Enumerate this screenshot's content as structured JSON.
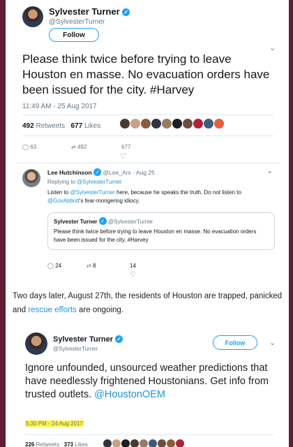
{
  "tweet1": {
    "name": "Sylvester Turner",
    "handle": "@SylvesterTurner",
    "follow_label": "Follow",
    "text": "Please think twice before trying to leave Houston en masse. No evacuation orders have been issued for the city. #Harvey",
    "time": "11:49 AM - 25 Aug 2017",
    "retweets_count": "492",
    "retweets_label": "Retweets",
    "likes_count": "677",
    "likes_label": "Likes",
    "reply_count": "63",
    "retweet_action_count": "492",
    "like_action_count": "677",
    "liker_colors": [
      "#4a3a30",
      "#c7a184",
      "#8a5c3b",
      "#2f3440",
      "#9b7a62",
      "#1e1e1e",
      "#6d4c3a",
      "#b22234",
      "#3d5a80",
      "#e0603a"
    ]
  },
  "reply": {
    "name": "Lee Hutchinson",
    "handle": "@Lee_Ars",
    "date": "· Aug 25",
    "replying_prefix": "Replying to",
    "replying_handle": "@SylvesterTurner",
    "body_1": "Listen to",
    "mention_1": "@SylvesterTurner",
    "body_2": "here, because he speaks the truth. Do not listen to",
    "mention_2": "@GovAbbott",
    "body_3": "'s fear-mongering idiocy.",
    "quote_name": "Sylvester Turner",
    "quote_handle": "@SylvesterTurner",
    "quote_text": "Please think twice before trying to leave Houston en masse. No evacuation orders have been issued for the city. #Harvey",
    "reply_count": "24",
    "retweet_count": "8",
    "like_count": "14"
  },
  "narration": {
    "part1": "Two days later, August 27th, the residents of Houston are trapped, panicked and ",
    "link": "rescue efforts",
    "part2": " are ongoing."
  },
  "tweet2": {
    "name": "Sylvester Turner",
    "handle": "@SylvesterTurner",
    "follow_label": "Follow",
    "text": "Ignore unfounded, unsourced weather predictions that have needlessly frightened Houstonians. Get info from trusted outlets.",
    "mention": "@HoustonOEM",
    "time": "5:30 PM - 24 Aug 2017",
    "retweets_count": "226",
    "retweets_label": "Retweets",
    "likes_count": "373",
    "likes_label": "Likes",
    "liker_colors": [
      "#2f3440",
      "#c7a184",
      "#1e1e1e",
      "#4a3a30",
      "#9b7a62",
      "#3d5a80",
      "#6d4c3a",
      "#8a5c3b",
      "#b22234"
    ]
  },
  "colors": {
    "frame": "#5e1f35",
    "link_blue": "#1b95e0",
    "verified_blue": "#1da1f2",
    "highlight": "#fff33a"
  },
  "icons": [
    "verified-icon",
    "chevron-down-icon",
    "reply-icon",
    "retweet-icon",
    "heart-icon"
  ]
}
